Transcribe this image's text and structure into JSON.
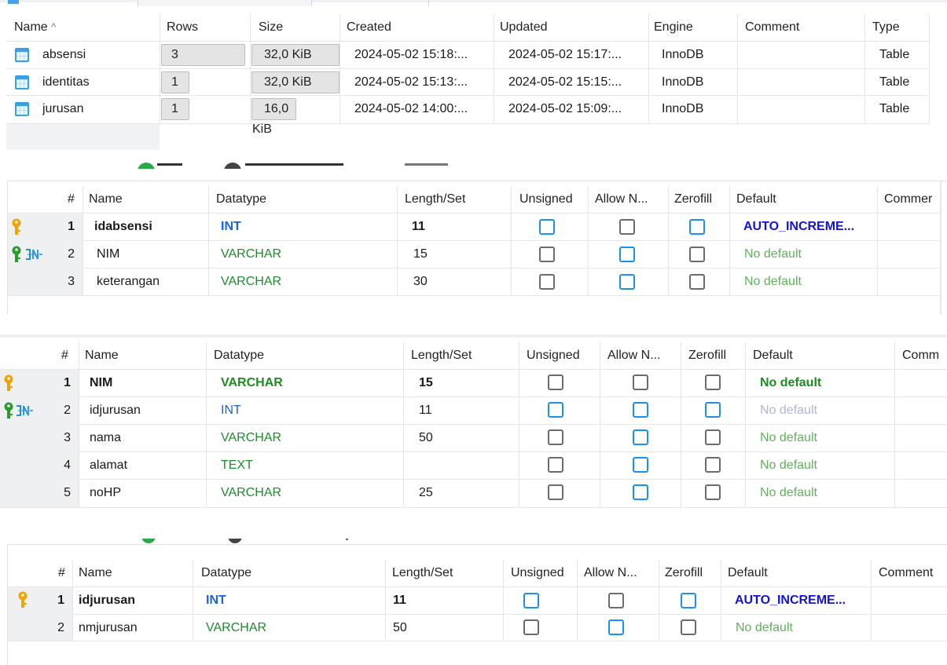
{
  "tables_list": {
    "headers": [
      "Name",
      "Rows",
      "Size",
      "Created",
      "Updated",
      "Engine",
      "Comment",
      "Type"
    ],
    "sort_indicator": "^",
    "rows": [
      {
        "name": "absensi",
        "rows": "3",
        "size_num": "32,0",
        "size_unit": "KiB",
        "created": "2024-05-02 15:18:...",
        "updated": "2024-05-02 15:17:...",
        "engine": "InnoDB",
        "comment": "",
        "type": "Table",
        "rows_fill": 1.0,
        "size_fill": 1.0
      },
      {
        "name": "identitas",
        "rows": "1",
        "size_num": "32,0",
        "size_unit": "KiB",
        "created": "2024-05-02 15:13:...",
        "updated": "2024-05-02 15:15:...",
        "engine": "InnoDB",
        "comment": "",
        "type": "Table",
        "rows_fill": 0.33,
        "size_fill": 1.0
      },
      {
        "name": "jurusan",
        "rows": "1",
        "size_num": "16,0",
        "size_unit": "KiB",
        "created": "2024-05-02 14:00:...",
        "updated": "2024-05-02 15:09:...",
        "engine": "InnoDB",
        "comment": "",
        "type": "Table",
        "rows_fill": 0.33,
        "size_fill": 0.5
      }
    ]
  },
  "editor_absensi": {
    "headers": [
      "#",
      "Name",
      "Datatype",
      "Length/Set",
      "Unsigned",
      "Allow N...",
      "Zerofill",
      "Default",
      "Commer"
    ],
    "rows": [
      {
        "idx": "1",
        "name": "idabsensi",
        "datatype": "INT",
        "length": "11",
        "unsigned": true,
        "allow_null": false,
        "zerofill": true,
        "default": "AUTO_INCREME...",
        "keys": [
          "primary-key"
        ]
      },
      {
        "idx": "2",
        "name": "NIM",
        "datatype": "VARCHAR",
        "length": "15",
        "unsigned": false,
        "allow_null": true,
        "zerofill": false,
        "default": "No default",
        "keys": [
          "primary-key-green",
          "foreign-key"
        ]
      },
      {
        "idx": "3",
        "name": "keterangan",
        "datatype": "VARCHAR",
        "length": "30",
        "unsigned": false,
        "allow_null": true,
        "zerofill": false,
        "default": "No default",
        "keys": []
      }
    ]
  },
  "editor_identitas": {
    "headers": [
      "#",
      "Name",
      "Datatype",
      "Length/Set",
      "Unsigned",
      "Allow N...",
      "Zerofill",
      "Default",
      "Comm"
    ],
    "rows": [
      {
        "idx": "1",
        "name": "NIM",
        "datatype": "VARCHAR",
        "length": "15",
        "unsigned": false,
        "allow_null": false,
        "zerofill": false,
        "default": "No default",
        "keys": [
          "primary-key"
        ]
      },
      {
        "idx": "2",
        "name": "idjurusan",
        "datatype": "INT",
        "length": "11",
        "unsigned": true,
        "allow_null": true,
        "zerofill": true,
        "default": "No default",
        "keys": [
          "primary-key-green",
          "foreign-key"
        ]
      },
      {
        "idx": "3",
        "name": "nama",
        "datatype": "VARCHAR",
        "length": "50",
        "unsigned": false,
        "allow_null": true,
        "zerofill": false,
        "default": "No default",
        "keys": []
      },
      {
        "idx": "4",
        "name": "alamat",
        "datatype": "TEXT",
        "length": "",
        "unsigned": false,
        "allow_null": true,
        "zerofill": false,
        "default": "No default",
        "keys": []
      },
      {
        "idx": "5",
        "name": "noHP",
        "datatype": "VARCHAR",
        "length": "25",
        "unsigned": false,
        "allow_null": true,
        "zerofill": false,
        "default": "No default",
        "keys": []
      }
    ]
  },
  "editor_jurusan": {
    "headers": [
      "#",
      "Name",
      "Datatype",
      "Length/Set",
      "Unsigned",
      "Allow N...",
      "Zerofill",
      "Default",
      "Comment"
    ],
    "rows": [
      {
        "idx": "1",
        "name": "idjurusan",
        "datatype": "INT",
        "length": "11",
        "unsigned": true,
        "allow_null": false,
        "zerofill": true,
        "default": "AUTO_INCREME...",
        "keys": [
          "primary-key"
        ]
      },
      {
        "idx": "2",
        "name": "nmjurusan",
        "datatype": "VARCHAR",
        "length": "50",
        "unsigned": false,
        "allow_null": true,
        "zerofill": false,
        "default": "No default",
        "keys": []
      }
    ]
  },
  "colors": {
    "checkbox_on": "#1e90e6",
    "checkbox_off": "#6b6b6b",
    "type_int": "#1c63d8",
    "type_varchar": "#1f8a2e",
    "default_auto": "#1212d8",
    "default_no": "#5fb25a",
    "key_gold": "#f0a400",
    "key_green": "#2c9a2c",
    "table_icon": "#3aa0de"
  }
}
